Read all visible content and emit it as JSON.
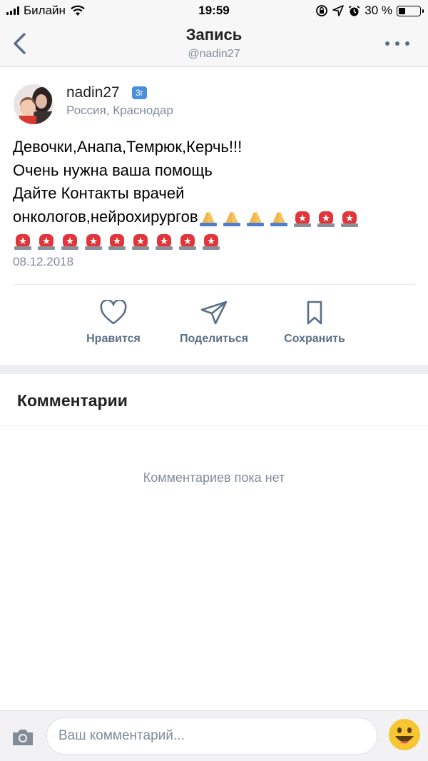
{
  "status_bar": {
    "carrier": "Билайн",
    "time": "19:59",
    "battery": "30 %",
    "battery_level": 0.3
  },
  "nav": {
    "title": "Запись",
    "subtitle": "@nadin27"
  },
  "post": {
    "author": "nadin27",
    "badge": "3г",
    "location": "Россия, Краснодар",
    "text_lines": [
      "Девочки,Анапа,Темрюк,Керчь!!!",
      "Очень нужна ваша помощь",
      "Дайте Контакты врачей",
      "онкологов,нейрохирургов"
    ],
    "date": "08.12.2018"
  },
  "actions": {
    "like": "Нравится",
    "share": "Поделиться",
    "save": "Сохранить"
  },
  "comments": {
    "title": "Комментарии",
    "empty": "Комментариев пока нет"
  },
  "composer": {
    "placeholder": "Ваш комментарий..."
  }
}
